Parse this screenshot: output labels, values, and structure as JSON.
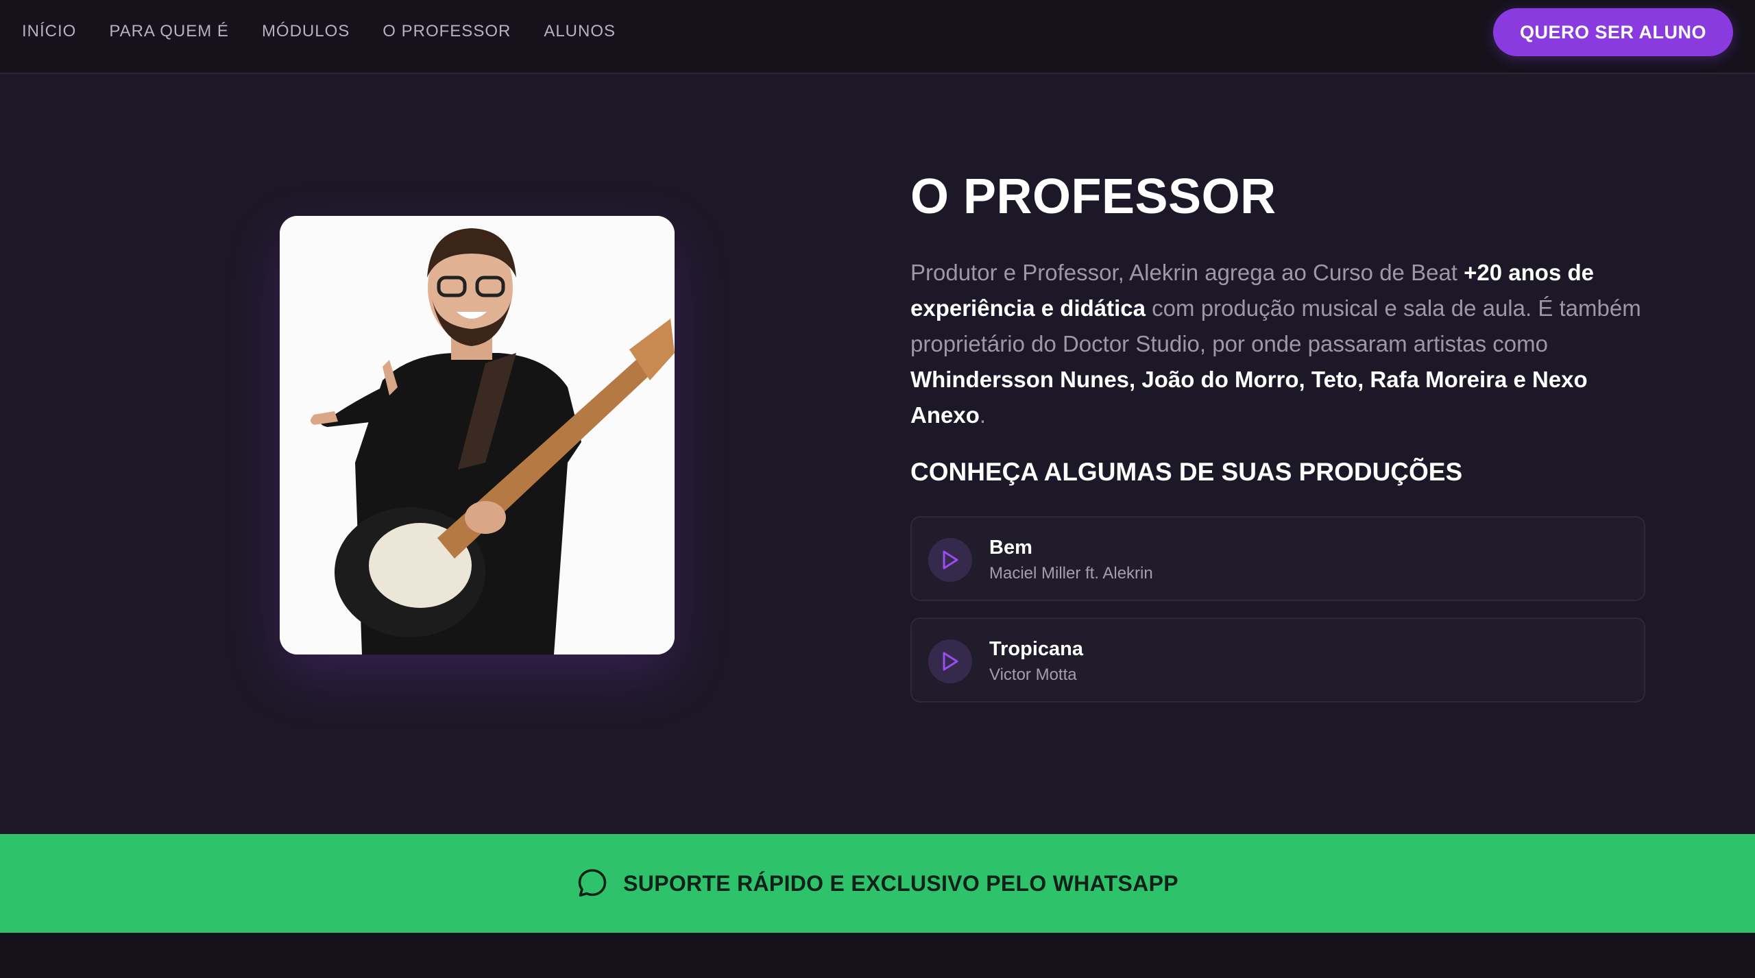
{
  "nav": {
    "links": [
      "INÍCIO",
      "PARA QUEM É",
      "MÓDULOS",
      "O PROFESSOR",
      "ALUNOS"
    ],
    "cta_label": "QUERO SER ALUNO"
  },
  "professor": {
    "title": "O PROFESSOR",
    "bio": {
      "part1": "Produtor e Professor, Alekrin agrega ao Curso de Beat ",
      "highlight1": "+20 anos de experiência e didática",
      "part2": " com produção musical e sala de aula. É também proprietário do Doctor Studio, por onde passaram artistas como ",
      "highlight2": "Whindersson Nunes, João do Morro, Teto, Rafa Moreira e Nexo Anexo",
      "part3": "."
    },
    "productions_heading": "CONHEÇA ALGUMAS DE SUAS PRODUÇÕES",
    "tracks": [
      {
        "title": "Bem",
        "artist": "Maciel Miller ft. Alekrin"
      },
      {
        "title": "Tropicana",
        "artist": "Victor Motta"
      }
    ]
  },
  "support": {
    "label": "SUPORTE RÁPIDO E EXCLUSIVO PELO WHATSAPP",
    "icon": "whatsapp-chat-icon"
  },
  "colors": {
    "accent": "#8a3be0",
    "background": "#1d1827",
    "nav_bg": "#15121b",
    "whatsapp_green": "#2ec26a"
  },
  "icons": {
    "play": "play-icon",
    "whatsapp": "whatsapp-chat-icon"
  }
}
